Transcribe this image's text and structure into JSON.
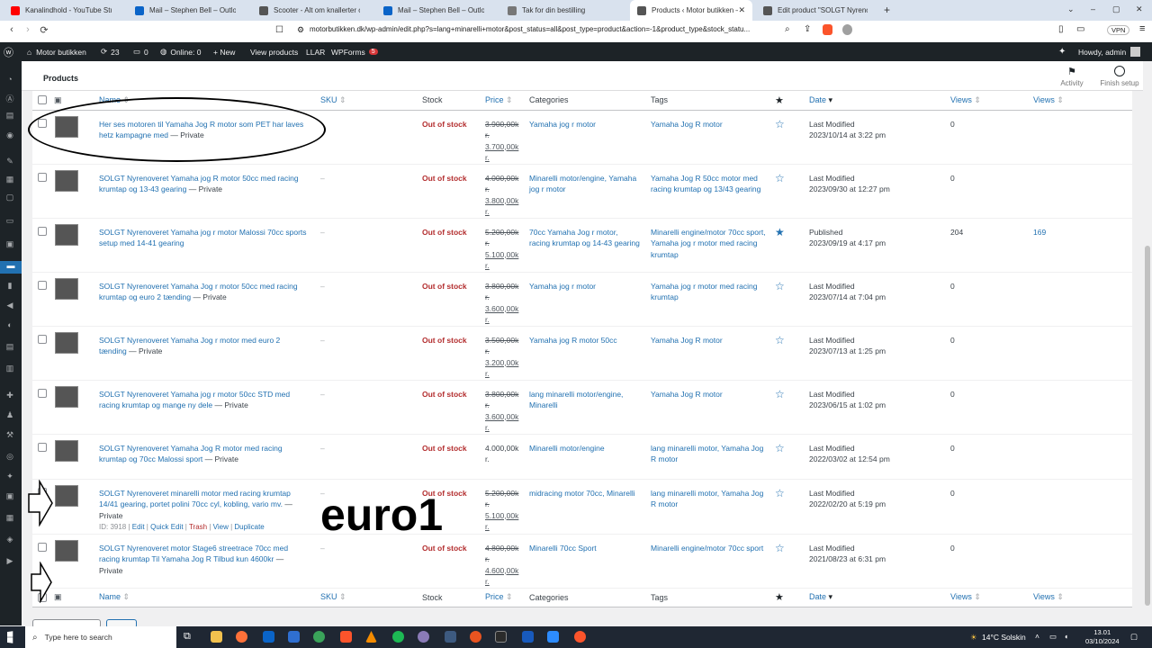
{
  "browser": {
    "tabs": [
      {
        "label": "Kanalindhold - YouTube Studio",
        "color": "#ff0000"
      },
      {
        "label": "Mail – Stephen Bell – Outlook",
        "color": "#0a64c8"
      },
      {
        "label": "Scooter - Alt om knallerter og scoo",
        "color": "#555555"
      },
      {
        "label": "Mail – Stephen Bell – Outlook",
        "color": "#0a64c8"
      },
      {
        "label": "Tak for din bestilling",
        "color": "#777777"
      },
      {
        "label": "Products ‹ Motor butikken — W",
        "color": "#555555"
      },
      {
        "label": "Edit product \"SOLGT Nyrenoveret Y",
        "color": "#555555"
      }
    ],
    "url": "motorbutikken.dk/wp-admin/edit.php?s=lang+minarelli+motor&post_status=all&post_type=product&action=-1&product_type&stock_statu...",
    "vpn": "VPN"
  },
  "adminbar": {
    "site": "Motor butikken",
    "updates": "23",
    "comments": "0",
    "online": "Online: 0",
    "new": "+ New",
    "view_products": "View products",
    "llar": "LLAR",
    "wpforms": "WPForms",
    "wpforms_count": "5",
    "howdy": "Howdy, admin"
  },
  "header": {
    "title": "Products",
    "activity": "Activity",
    "finish_setup": "Finish setup"
  },
  "columns": {
    "name": "Name",
    "sku": "SKU",
    "stock": "Stock",
    "price": "Price",
    "categories": "Categories",
    "tags": "Tags",
    "date": "Date",
    "views1": "Views",
    "views2": "Views"
  },
  "products": [
    {
      "name": "Her ses motoren til Yamaha Jog R motor som PET har laves hetz kampagne med",
      "status": "— Private",
      "sku": "",
      "stock": "Out of stock",
      "price_old": "3.900,00k r.",
      "price_new": "3.700,00k r.",
      "categories": "Yamaha jog r motor",
      "tags": "Yamaha Jog R motor",
      "featured": false,
      "date_label": "Last Modified",
      "date": "2023/10/14 at 3:22 pm",
      "views1": "0",
      "views2": ""
    },
    {
      "name": "SOLGT Nyrenoveret Yamaha jog R motor 50cc med racing krumtap og 13-43 gearing",
      "status": "— Private",
      "sku": "–",
      "stock": "Out of stock",
      "price_old": "4.000,00k r.",
      "price_new": "3.800,00k r.",
      "categories": "Minarelli motor/engine, Yamaha jog r motor",
      "tags": "Yamaha Jog R 50cc motor med racing krumtap og 13/43 gearing",
      "featured": false,
      "date_label": "Last Modified",
      "date": "2023/09/30 at 12:27 pm",
      "views1": "0",
      "views2": ""
    },
    {
      "name": "SOLGT Nyrenoveret Yamaha jog r motor Malossi 70cc sports setup med 14-41 gearing",
      "status": "",
      "sku": "–",
      "stock": "Out of stock",
      "price_old": "5.200,00k r.",
      "price_new": "5.100,00k r.",
      "categories": "70cc Yamaha Jog r motor, racing krumtap og 14-43 gearing",
      "tags": "Minarelli engine/motor 70cc sport, Yamaha jog r motor med racing krumtap",
      "featured": true,
      "date_label": "Published",
      "date": "2023/09/19 at 4:17 pm",
      "views1": "204",
      "views2": "169"
    },
    {
      "name": "SOLGT Nyrenoveret Yamaha Jog r motor 50cc med racing krumtap og euro 2 tænding",
      "status": "— Private",
      "sku": "–",
      "stock": "Out of stock",
      "price_old": "3.800,00k r.",
      "price_new": "3.600,00k r.",
      "categories": "Yamaha jog r motor",
      "tags": "Yamaha jog r motor med racing krumtap",
      "featured": false,
      "date_label": "Last Modified",
      "date": "2023/07/14 at 7:04 pm",
      "views1": "0",
      "views2": ""
    },
    {
      "name": "SOLGT Nyrenoveret Yamaha Jog r motor med euro 2 tænding",
      "status": "— Private",
      "sku": "–",
      "stock": "Out of stock",
      "price_old": "3.500,00k r.",
      "price_new": "3.200,00k r.",
      "categories": "Yamaha jog R motor 50cc",
      "tags": "Yamaha Jog R motor",
      "featured": false,
      "date_label": "Last Modified",
      "date": "2023/07/13 at 1:25 pm",
      "views1": "0",
      "views2": ""
    },
    {
      "name": "SOLGT Nyrenoveret Yamaha jog r motor 50cc STD med racing krumtap og mange ny dele",
      "status": "— Private",
      "sku": "–",
      "stock": "Out of stock",
      "price_old": "3.800,00k r.",
      "price_new": "3.600,00k r.",
      "categories": "lang minarelli motor/engine, Minarelli",
      "tags": "Yamaha Jog R motor",
      "featured": false,
      "date_label": "Last Modified",
      "date": "2023/06/15 at 1:02 pm",
      "views1": "0",
      "views2": ""
    },
    {
      "name": "SOLGT Nyrenoveret Yamaha Jog R motor med racing krumtap og 70cc Malossi sport",
      "status": "— Private",
      "sku": "–",
      "stock": "Out of stock",
      "price_old": "",
      "price_new": "4.000,00k r.",
      "categories": "Minarelli motor/engine",
      "tags": "lang minarelli motor, Yamaha Jog R motor",
      "featured": false,
      "date_label": "Last Modified",
      "date": "2022/03/02 at 12:54 pm",
      "views1": "0",
      "views2": ""
    },
    {
      "name": "SOLGT Nyrenoveret minarelli motor med racing krumtap 14/41 gearing, portet polini 70cc cyl, kobling, vario mv.",
      "status": "— Private",
      "sku": "–",
      "stock": "Out of stock",
      "price_old": "5.200,00k r.",
      "price_new": "5.100,00k r.",
      "categories": "midracing motor 70cc, Minarelli",
      "tags": "lang minarelli motor, Yamaha Jog R motor",
      "featured": false,
      "date_label": "Last Modified",
      "date": "2022/02/20 at 5:19 pm",
      "views1": "0",
      "views2": "",
      "row_actions": {
        "id": "ID: 3918",
        "edit": "Edit",
        "quick_edit": "Quick Edit",
        "trash": "Trash",
        "view": "View",
        "duplicate": "Duplicate"
      }
    },
    {
      "name": "SOLGT Nyrenoveret motor Stage6 streetrace 70cc med racing krumtap Til Yamaha Jog R Tilbud kun 4600kr",
      "status": "— Private",
      "sku": "–",
      "stock": "Out of stock",
      "price_old": "4.800,00k r.",
      "price_new": "4.600,00k r.",
      "categories": "Minarelli 70cc Sport",
      "tags": "Minarelli engine/motor 70cc sport",
      "featured": false,
      "date_label": "Last Modified",
      "date": "2021/08/23 at 6:31 pm",
      "views1": "0",
      "views2": ""
    }
  ],
  "annotation": {
    "text": "euro1"
  },
  "taskbar": {
    "search_placeholder": "Type here to search",
    "weather": "14°C  Solskin",
    "time": "13.01",
    "date": "03/10/2024"
  }
}
